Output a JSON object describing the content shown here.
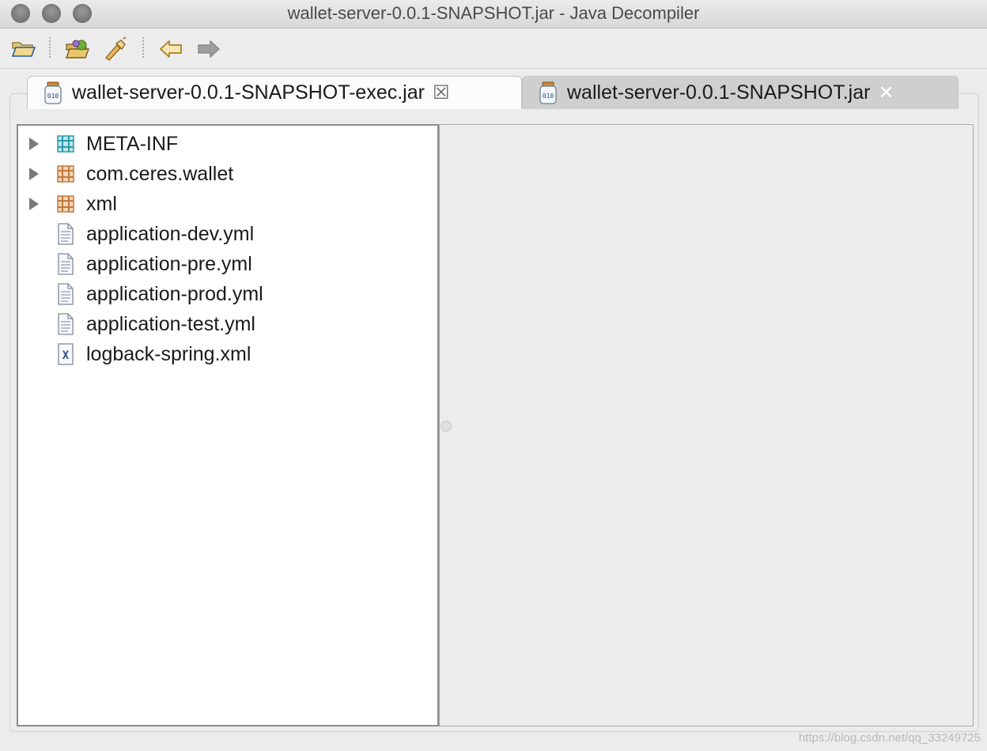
{
  "window": {
    "title": "wallet-server-0.0.1-SNAPSHOT.jar - Java Decompiler"
  },
  "toolbar": {
    "buttons": [
      {
        "name": "open-file",
        "icon": "folder-open-icon"
      },
      {
        "name": "open-type",
        "icon": "package-open-icon"
      },
      {
        "name": "search",
        "icon": "flashlight-icon"
      },
      {
        "name": "back",
        "icon": "arrow-left-icon"
      },
      {
        "name": "forward",
        "icon": "arrow-right-icon"
      }
    ]
  },
  "tabs": [
    {
      "label": "wallet-server-0.0.1-SNAPSHOT-exec.jar",
      "close": "☒",
      "active": false
    },
    {
      "label": "wallet-server-0.0.1-SNAPSHOT.jar",
      "close": "✕",
      "active": true
    }
  ],
  "tree": {
    "items": [
      {
        "label": "META-INF",
        "type": "folder-package",
        "expandable": true
      },
      {
        "label": "com.ceres.wallet",
        "type": "package",
        "expandable": true
      },
      {
        "label": "xml",
        "type": "package",
        "expandable": true
      },
      {
        "label": "application-dev.yml",
        "type": "file",
        "expandable": false
      },
      {
        "label": "application-pre.yml",
        "type": "file",
        "expandable": false
      },
      {
        "label": "application-prod.yml",
        "type": "file",
        "expandable": false
      },
      {
        "label": "application-test.yml",
        "type": "file",
        "expandable": false
      },
      {
        "label": "logback-spring.xml",
        "type": "xml-file",
        "expandable": false
      }
    ]
  },
  "watermark": "https://blog.csdn.net/qq_33249725",
  "colors": {
    "package_orange": "#c27a3e",
    "package_teal": "#2a9aa8"
  }
}
